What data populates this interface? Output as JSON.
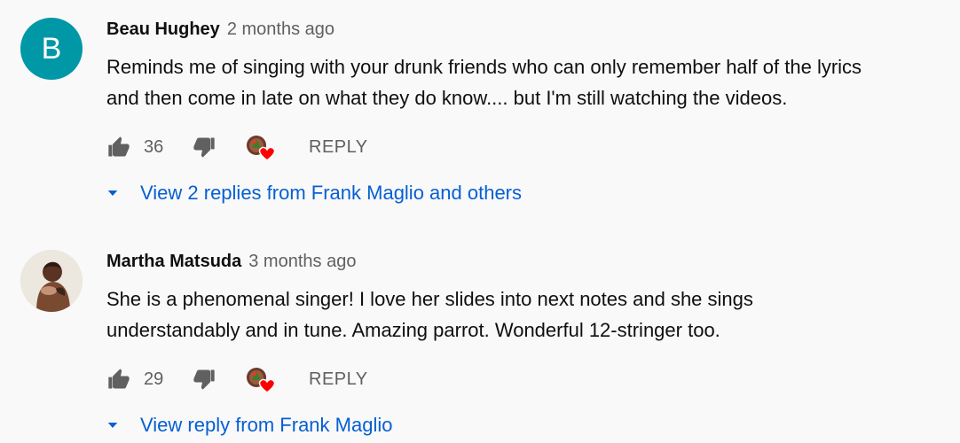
{
  "comments": [
    {
      "author": "Beau Hughey",
      "time": "2 months ago",
      "avatar_letter": "B",
      "avatar_color": "#0097a7",
      "lines": [
        "Reminds me of singing with your drunk friends who can only remember half of the lyrics",
        "and then come in late on what they do know.... but I'm still watching the videos."
      ],
      "likes": "36",
      "reply_label": "REPLY",
      "replies_label": "View 2 replies from Frank Maglio and others"
    },
    {
      "author": "Martha Matsuda",
      "time": "3 months ago",
      "lines": [
        "She is a phenomenal singer!  I love her slides into next notes and she sings",
        "understandably and in tune.  Amazing parrot.  Wonderful 12-stringer too."
      ],
      "likes": "29",
      "reply_label": "REPLY",
      "replies_label": "View reply from Frank Maglio"
    }
  ],
  "icons": {
    "like": "thumb-up-icon",
    "dislike": "thumb-down-icon",
    "creator_heart": "creator-heart-icon",
    "expand": "chevron-down-icon"
  },
  "colors": {
    "link_blue": "#065fd4",
    "heart_red": "#ff0000",
    "secondary_text": "#606060"
  }
}
